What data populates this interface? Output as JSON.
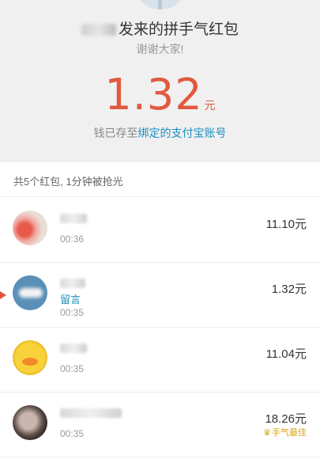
{
  "header": {
    "sender_suffix": "发来的拼手气红包",
    "thanks": "谢谢大家!",
    "amount": "1.32",
    "unit": "元",
    "saved_prefix": "钱已存至",
    "saved_link": "绑定的支付宝账号"
  },
  "summary": {
    "text": "共5个红包, 1分钟被抢光"
  },
  "rows": [
    {
      "avatar_icon": "user-avatar-icon",
      "time": "00:36",
      "amount": "11.10元",
      "leave_message": "",
      "best": ""
    },
    {
      "avatar_icon": "user-avatar-icon",
      "time": "00:35",
      "amount": "1.32元",
      "leave_message": "留言",
      "best": ""
    },
    {
      "avatar_icon": "duck-avatar-icon",
      "time": "00:35",
      "amount": "11.04元",
      "leave_message": "",
      "best": ""
    },
    {
      "avatar_icon": "user-avatar-icon",
      "time": "00:35",
      "amount": "18.26元",
      "leave_message": "",
      "best": "手气最佳",
      "best_icon": "crown-icon"
    }
  ],
  "colors": {
    "amount": "#e05a3f",
    "link": "#1e8fbd",
    "best": "#d9a514",
    "header_bg": "#f0f0f0"
  }
}
